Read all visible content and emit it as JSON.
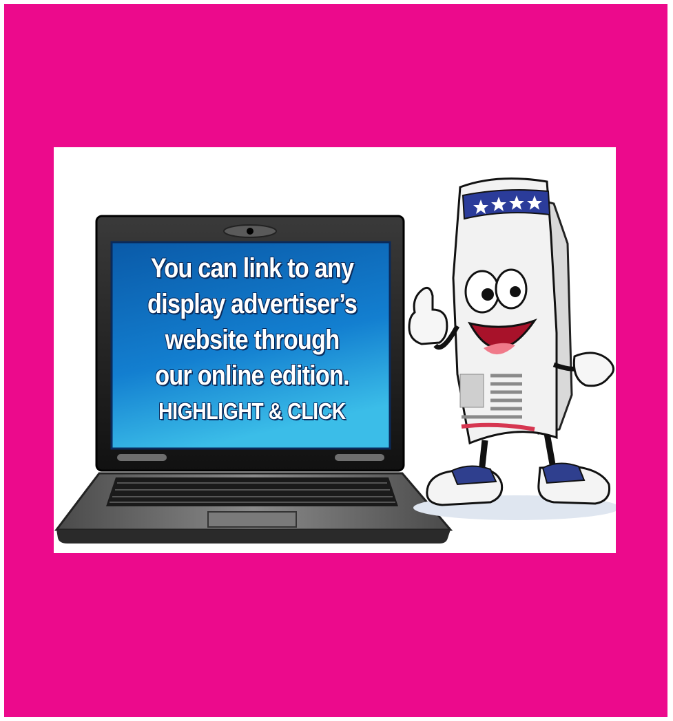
{
  "colors": {
    "frame": "#ec0a8c",
    "card": "#ffffff",
    "screen": "#0f78c8",
    "laptop_body": "#6a6a6a",
    "mascot_stripe_blue": "#2b3c9a",
    "mascot_stripe_red": "#d63650"
  },
  "screen": {
    "headline": "You can link to any\ndisplay advertiser’s\nwebsite through\nour online edition.",
    "cta": "HIGHLIGHT & CLICK"
  },
  "illustrations": {
    "laptop": "laptop-icon",
    "mascot": "newspaper-mascot-thumbs-up"
  }
}
